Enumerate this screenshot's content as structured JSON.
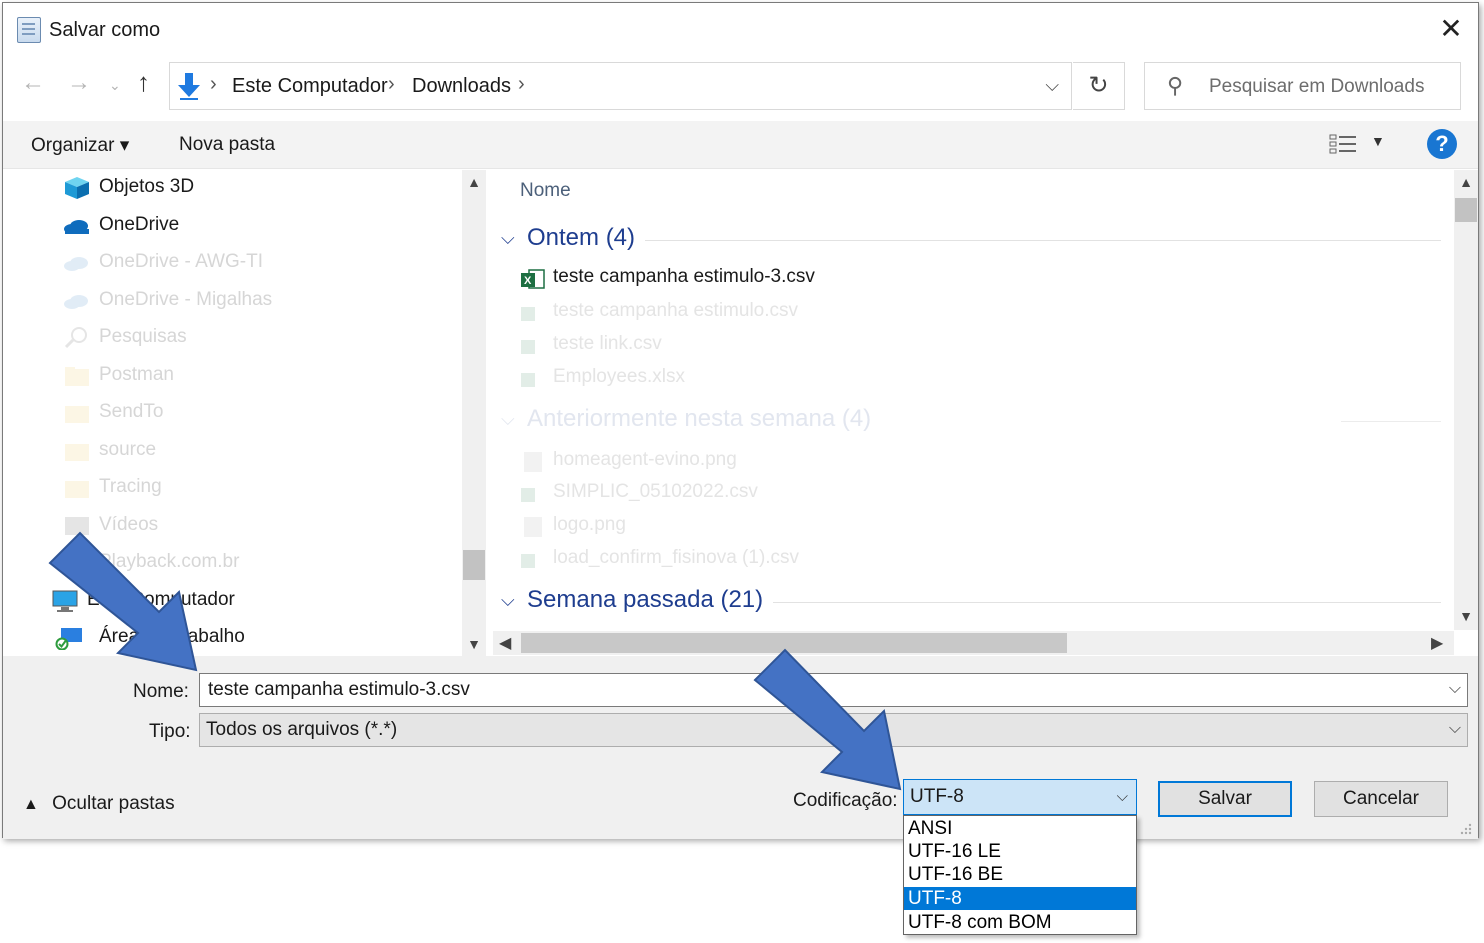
{
  "window": {
    "title": "Salvar como",
    "close": "✕"
  },
  "address": {
    "crumbs": [
      "Este Computador",
      "Downloads"
    ],
    "separator": "›",
    "search_placeholder": "Pesquisar em Downloads"
  },
  "toolbar": {
    "organize": "Organizar ▾",
    "new_folder": "Nova pasta",
    "help": "?"
  },
  "nav_items": [
    {
      "label": "Objetos 3D",
      "icon": "cube-3d-icon",
      "faded": false
    },
    {
      "label": "OneDrive",
      "icon": "cloud-icon",
      "faded": false
    },
    {
      "label": "OneDrive - AWG-TI",
      "icon": "cloud-icon",
      "faded": true
    },
    {
      "label": "OneDrive - Migalhas",
      "icon": "cloud-icon",
      "faded": true
    },
    {
      "label": "Pesquisas",
      "icon": "search-icon",
      "faded": true
    },
    {
      "label": "Postman",
      "icon": "folder-icon",
      "faded": true
    },
    {
      "label": "SendTo",
      "icon": "folder-icon",
      "faded": true
    },
    {
      "label": "source",
      "icon": "folder-icon",
      "faded": true
    },
    {
      "label": "Tracing",
      "icon": "folder-icon",
      "faded": true
    },
    {
      "label": "Vídeos",
      "icon": "video-icon",
      "faded": true
    },
    {
      "label": "Playback.com.br",
      "icon": "folder-icon",
      "faded": true
    },
    {
      "label": "Este Computador",
      "icon": "computer-icon",
      "faded": false
    },
    {
      "label": "Área de Trabalho",
      "icon": "desktop-icon",
      "faded": false
    }
  ],
  "files": {
    "column_name": "Nome",
    "groups": [
      {
        "label": "Ontem (4)",
        "faded": false,
        "items": [
          {
            "name": "teste campanha estimulo-3.csv",
            "faded": false
          },
          {
            "name": "teste campanha estimulo.csv",
            "faded": true
          },
          {
            "name": "teste link.csv",
            "faded": true
          },
          {
            "name": "Employees.xlsx",
            "faded": true
          }
        ]
      },
      {
        "label": "Anteriormente nesta semana (4)",
        "faded": true,
        "items": [
          {
            "name": "homeagent-evino.png",
            "faded": true
          },
          {
            "name": "SIMPLIC_05102022.csv",
            "faded": true
          },
          {
            "name": "logo.png",
            "faded": true
          },
          {
            "name": "load_confirm_fisinova (1).csv",
            "faded": true
          }
        ]
      },
      {
        "label": "Semana passada (21)",
        "faded": false,
        "items": []
      }
    ]
  },
  "form": {
    "name_label": "Nome:",
    "name_value": "teste campanha estimulo-3.csv",
    "type_label": "Tipo:",
    "type_value": "Todos os arquivos  (*.*)",
    "hide_folders": "Ocultar pastas",
    "encoding_label": "Codificação:",
    "encoding_value": "UTF-8",
    "encoding_options": [
      "ANSI",
      "UTF-16 LE",
      "UTF-16 BE",
      "UTF-8",
      "UTF-8 com BOM"
    ],
    "encoding_selected_index": 3,
    "save": "Salvar",
    "cancel": "Cancelar"
  },
  "colors": {
    "accent": "#0078d7",
    "annotation_arrow": "#4472c4",
    "group_header": "#1e3d8f"
  }
}
